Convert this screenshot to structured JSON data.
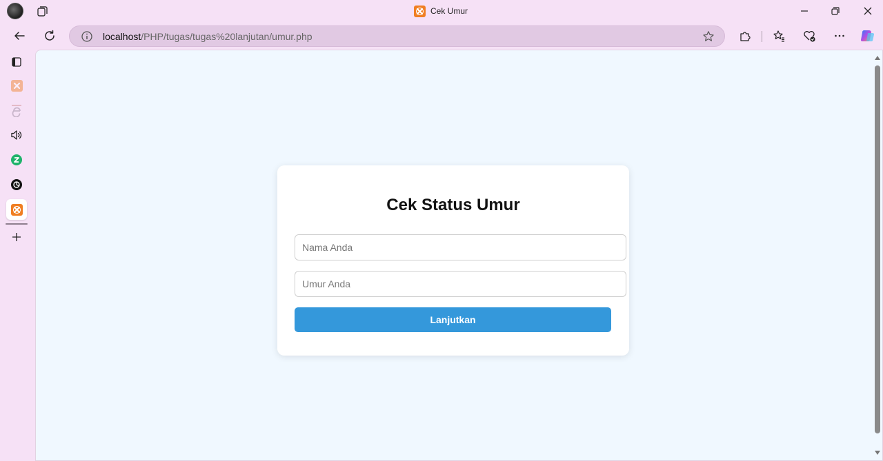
{
  "browser": {
    "tab_title": "Cek Umur",
    "url": {
      "host": "localhost",
      "path": "/PHP/tugas/tugas%20lanjutan/umur.php"
    },
    "accent_color": "#f6e1f6"
  },
  "icons": {
    "profile": "profile-avatar",
    "workspaces": "workspaces-icon",
    "back": "back-arrow-icon",
    "refresh": "refresh-icon",
    "site_info": "info-icon",
    "favorite": "star-icon",
    "extensions": "puzzle-icon",
    "favorites": "favorites-icon",
    "browser_essentials": "heart-pulse-icon",
    "more": "more-icon",
    "copilot": "copilot-icon"
  },
  "sidebar": {
    "items": [
      {
        "name": "vertical-tabs-toggle",
        "icon": "tab-panel-icon"
      },
      {
        "name": "xampp-tab",
        "icon": "xampp-icon"
      },
      {
        "name": "e-tab",
        "icon": "e-icon"
      },
      {
        "name": "audio-tab",
        "icon": "speaker-icon"
      },
      {
        "name": "zeta-tab",
        "icon": "z-icon"
      },
      {
        "name": "openai-tab",
        "icon": "openai-icon"
      },
      {
        "name": "xampp-active-tab",
        "icon": "xampp-icon"
      },
      {
        "name": "new-tab",
        "icon": "plus-icon"
      }
    ]
  },
  "page": {
    "background": "#f0f8ff",
    "title": "Cek Status Umur",
    "nama_placeholder": "Nama Anda",
    "umur_placeholder": "Umur Anda",
    "submit_label": "Lanjutkan",
    "button_color": "#3498db"
  }
}
